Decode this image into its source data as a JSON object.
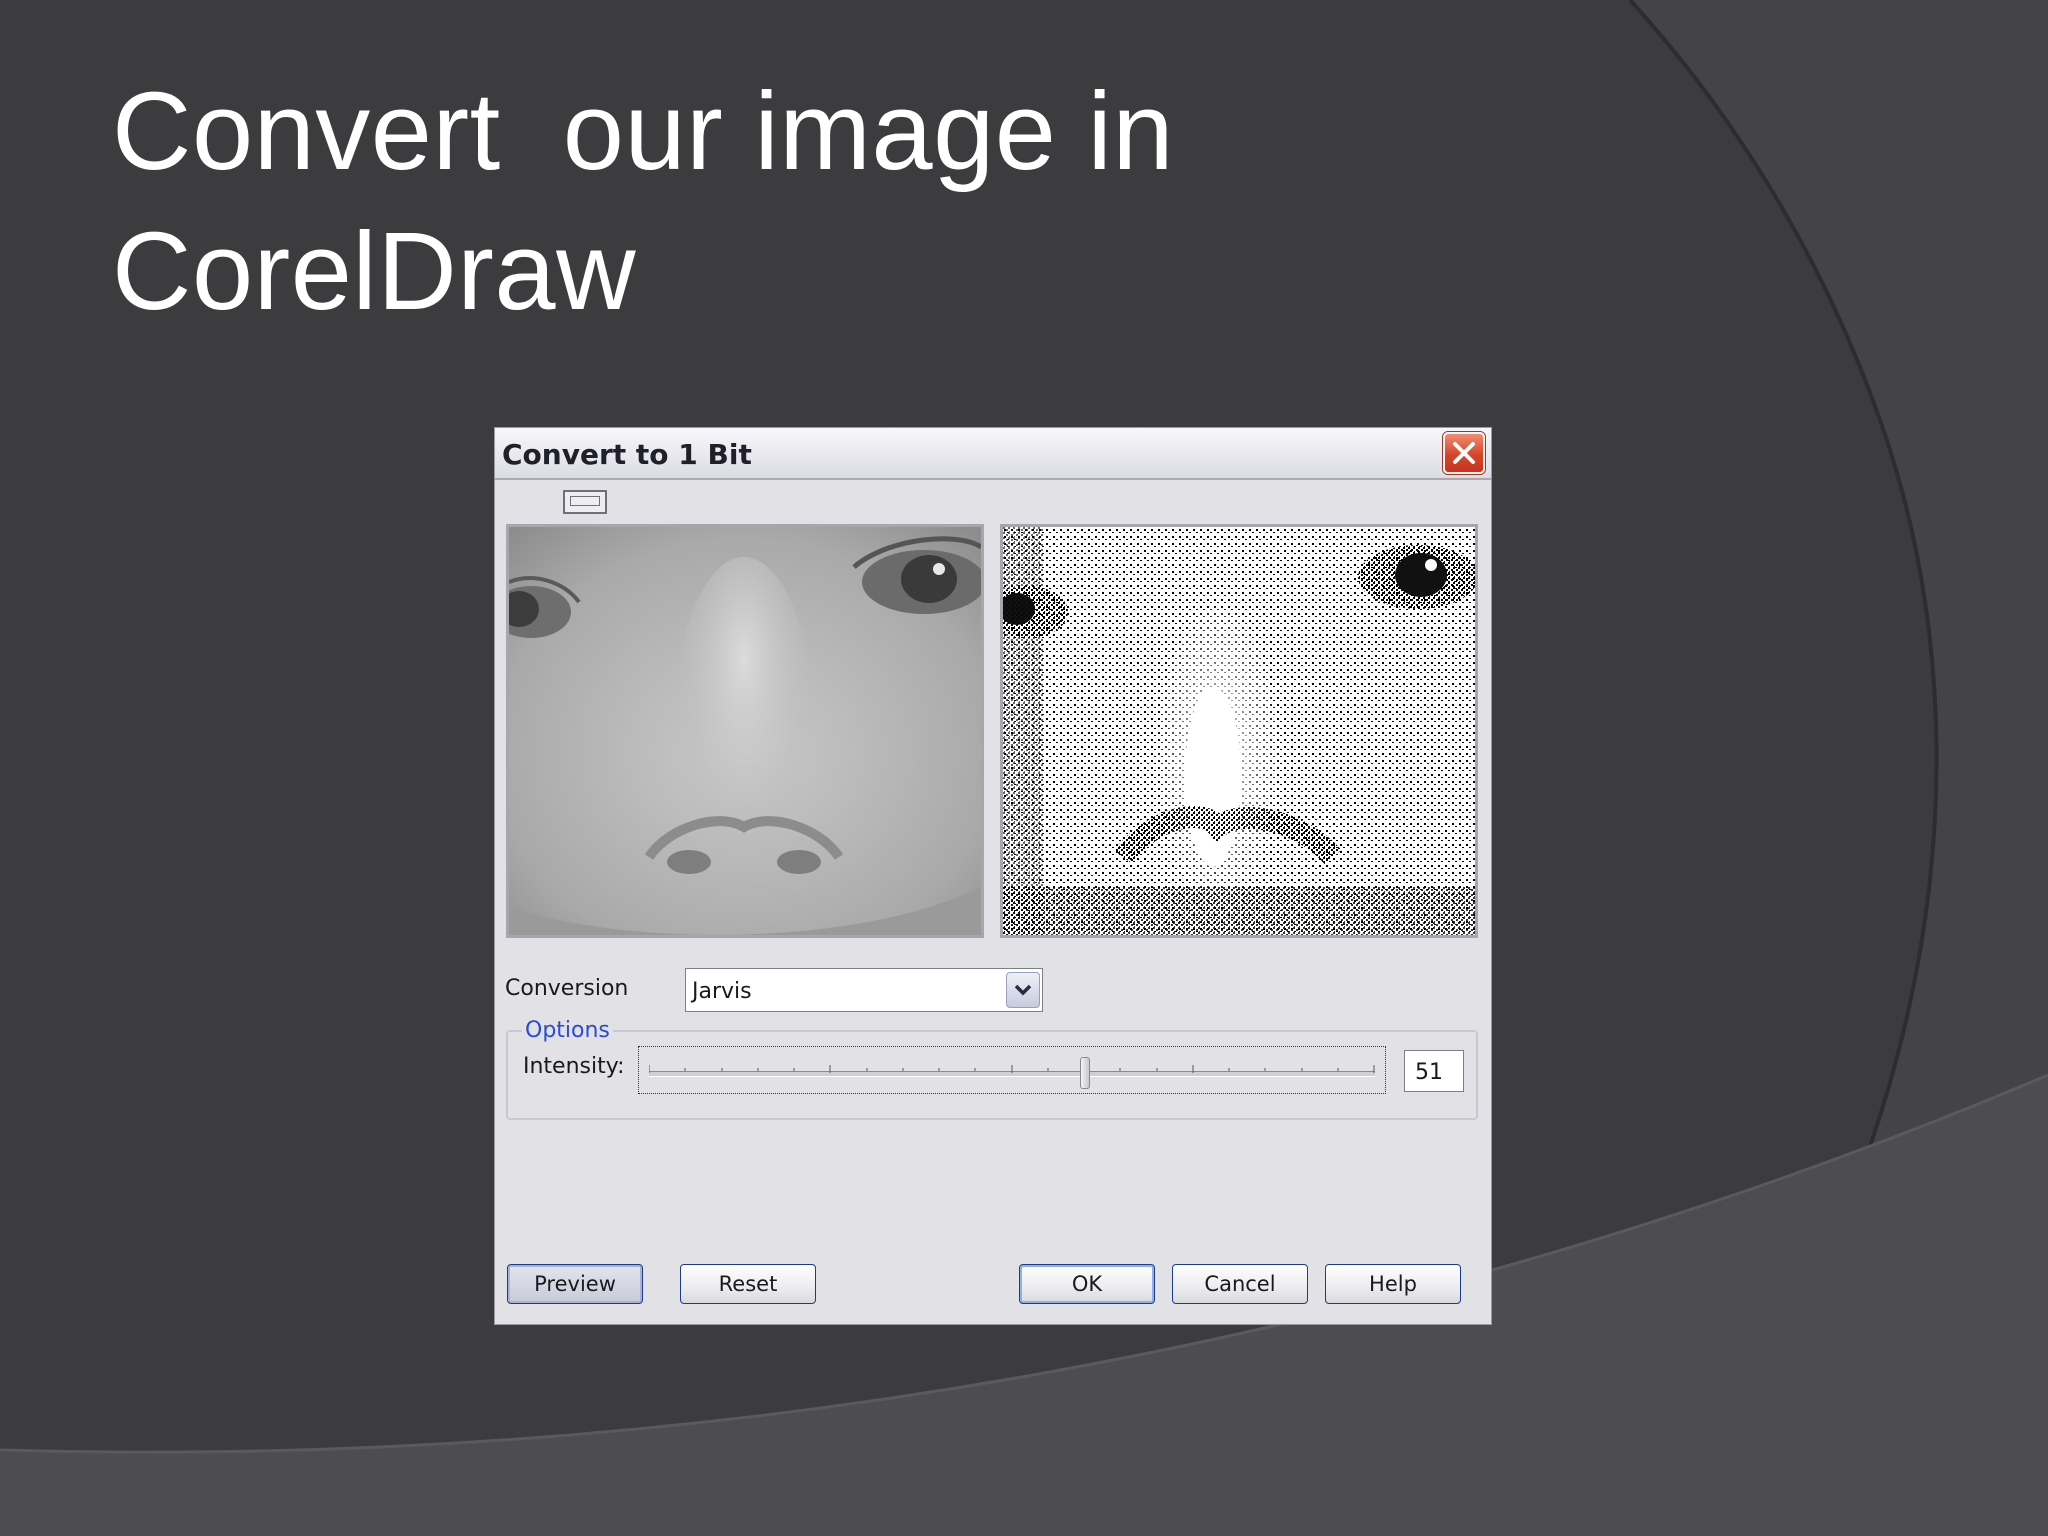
{
  "slide": {
    "title_line1": "Convert  our image in",
    "title_line2": "CorelDraw"
  },
  "colors": {
    "slide_background": "#3c3c3e",
    "dialog_background": "#e2e1e6",
    "options_legend": "#2b4bd0",
    "close_button": "#d6452a"
  },
  "dialog": {
    "title": "Convert to 1 Bit",
    "close_icon": "close-icon",
    "view_toggle_icon": "split-view-icon",
    "conversion": {
      "label": "Conversion",
      "selected": "Jarvis",
      "dropdown_icon": "chevron-down-icon"
    },
    "options": {
      "legend": "Options",
      "intensity_label": "Intensity:",
      "intensity_value": "51",
      "slider_level_percent": 60
    },
    "buttons": {
      "preview": "Preview",
      "reset": "Reset",
      "ok": "OK",
      "cancel": "Cancel",
      "help": "Help"
    }
  }
}
